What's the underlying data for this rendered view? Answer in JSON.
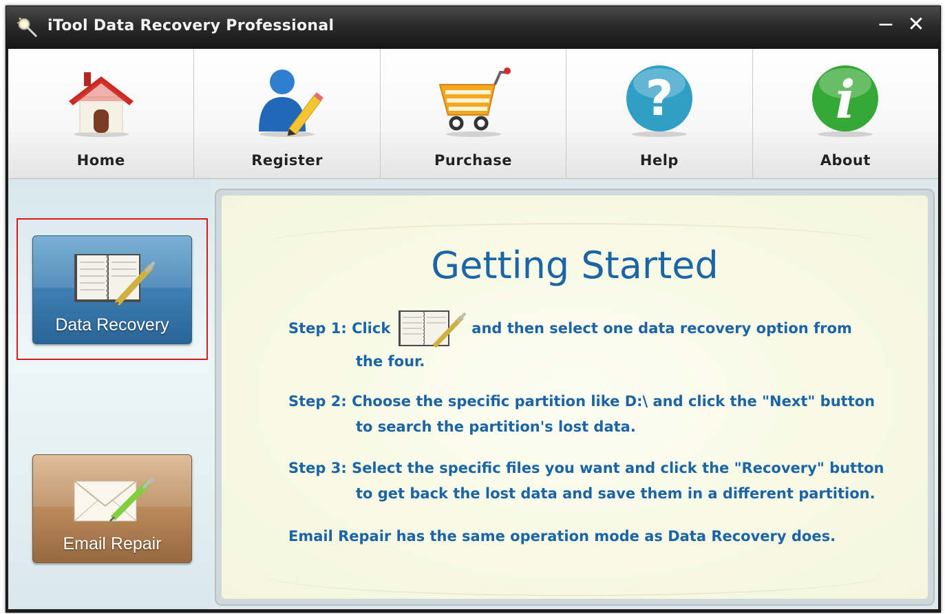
{
  "window": {
    "title": "iTool Data Recovery Professional",
    "minimize_glyph": "−",
    "close_glyph": "✕"
  },
  "toolbar": {
    "items": [
      {
        "label": "Home",
        "icon": "home-icon"
      },
      {
        "label": "Register",
        "icon": "register-icon"
      },
      {
        "label": "Purchase",
        "icon": "cart-icon"
      },
      {
        "label": "Help",
        "icon": "help-icon"
      },
      {
        "label": "About",
        "icon": "info-icon"
      }
    ]
  },
  "sidebar": {
    "data_recovery_label": "Data Recovery",
    "email_repair_label": "Email Repair"
  },
  "main": {
    "title": "Getting Started",
    "step1_prefix": "Step 1: Click",
    "step1_suffix": "and then select one data recovery option from",
    "step1_cont": "the four.",
    "step2_line1": "Step 2: Choose the specific partition like D:\\ and click the \"Next\" button",
    "step2_line2": "to search the partition's lost data.",
    "step3_line1": "Step 3: Select the specific files you want and click the \"Recovery\" button",
    "step3_line2": "to get back the lost data and save them in a different partition.",
    "note": "Email Repair has the same operation mode as Data Recovery does."
  },
  "colors": {
    "accent_text": "#1b64a5",
    "highlight_border": "#d21b1b",
    "recovery_button": "#3e7fb3",
    "email_button": "#b88a5c"
  }
}
